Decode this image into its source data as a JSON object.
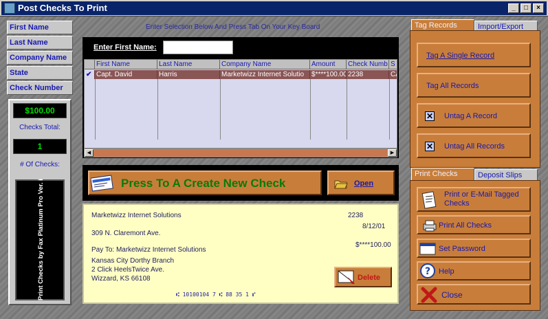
{
  "window": {
    "title": "Post Checks To Print",
    "min_symbol": "_",
    "max_symbol": "□",
    "close_symbol": "×"
  },
  "search_fields": [
    "First Name",
    "Last Name",
    "Company Name",
    "State",
    "Check Number"
  ],
  "totals": {
    "amount": "$100.00",
    "amount_label": "Checks Total:",
    "count": "1",
    "count_label": "# Of Checks:",
    "vertical_text": "Print Checks by Fax Platinum Pro Ver. i"
  },
  "instruction": "Enter Selection Below And Press Tab On Your Key Board",
  "search": {
    "label": "Enter First Name:",
    "value": ""
  },
  "grid": {
    "columns": [
      "First Name",
      "Last Name",
      "Company Name",
      "Amount",
      "Check Numb",
      "S"
    ],
    "rows": [
      {
        "checked": "✔",
        "cells": [
          "Capt. David",
          "Harris",
          "Marketwizz Internet Solutio",
          "$****100.00",
          "2238",
          "CA"
        ]
      }
    ]
  },
  "actions": {
    "new_check": "Press To  A Create New Check",
    "open": "Open",
    "delete": "Delete"
  },
  "check_preview": {
    "company": "Marketwizz Internet Solutions",
    "address": "309 N. Claremont Ave.",
    "check_no": "2238",
    "date": "8/12/01",
    "payee": "Pay To: Marketwizz Internet Solutions",
    "amount": "$****100.00",
    "bank_line1": "Kansas City Dorthy Branch",
    "bank_line2": "2 Click HeelsTwice Ave.",
    "bank_line3": "Wizzard, KS 66108",
    "micr": "⑆ 10100104 7  ⑆  88 35 1 ⑈"
  },
  "tabs_top": [
    "Tag Records",
    "Import/Export"
  ],
  "tag_buttons": [
    "Tag A Single Record",
    "Tag All Records",
    "Untag A  Record",
    "Untag All Records"
  ],
  "tabs_bottom": [
    "Print Checks",
    "Deposit Slips"
  ],
  "print_buttons": {
    "print_email": "Print  or E-Mail Tagged Checks",
    "print_all": "Print All Checks",
    "password": "Set Password",
    "help": "Help",
    "close": "Close"
  },
  "colors": {
    "title_bar": "#0a246a",
    "button_orange": "#c87e3a",
    "label_blue": "#1818b0",
    "selected_row": "#8a5555",
    "check_bg": "#ffffc4",
    "create_green": "#0a7a0a"
  }
}
